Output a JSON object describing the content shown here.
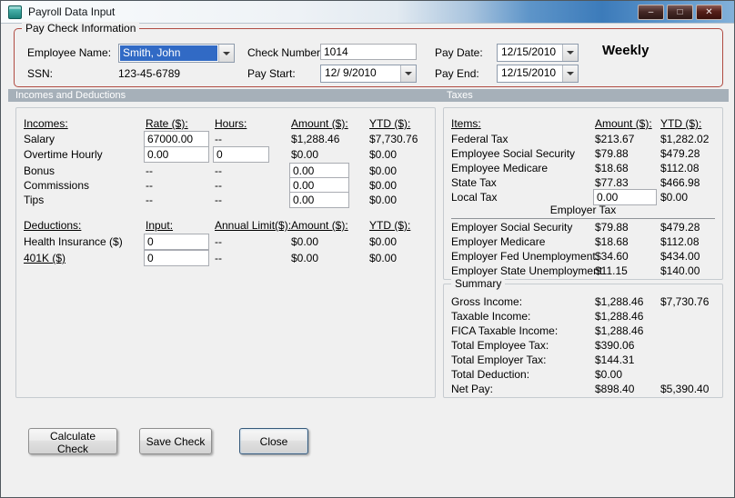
{
  "window": {
    "title": "Payroll Data Input",
    "buttons": {
      "minimize": "–",
      "maximize": "□",
      "close": "✕"
    }
  },
  "colors": {
    "paycheck_group_border": "#b04b42",
    "section_header_bg": "#a6b0b9",
    "selection_highlight": "#316ac5",
    "titlebar_blue": "#3c7bba"
  },
  "paycheck": {
    "group_label": "Pay Check Information",
    "employee_name_label": "Employee Name:",
    "employee_name_value": "Smith, John",
    "ssn_label": "SSN:",
    "ssn_value": "123-45-6789",
    "check_number_label": "Check Number:",
    "check_number_value": "1014",
    "pay_start_label": "Pay Start:",
    "pay_start_value": "12/ 9/2010",
    "pay_date_label": "Pay Date:",
    "pay_date_value": "12/15/2010",
    "pay_end_label": "Pay End:",
    "pay_end_value": "12/15/2010",
    "frequency": "Weekly"
  },
  "sections": {
    "incomes_deductions": "Incomes and Deductions",
    "taxes": "Taxes"
  },
  "incomes": {
    "headers": {
      "item": "Incomes:",
      "rate": "Rate ($):",
      "hours": "Hours:",
      "amount": "Amount ($):",
      "ytd": "YTD ($):"
    },
    "rows": [
      {
        "label": "Salary",
        "rate": "67000.00",
        "hours": "--",
        "amount": "$1,288.46",
        "ytd": "$7,730.76"
      },
      {
        "label": "Overtime Hourly",
        "rate": "0.00",
        "hours": "0",
        "amount": "$0.00",
        "ytd": "$0.00"
      },
      {
        "label": "Bonus",
        "rate": "--",
        "hours": "--",
        "amount": "0.00",
        "ytd": "$0.00"
      },
      {
        "label": "Commissions",
        "rate": "--",
        "hours": "--",
        "amount": "0.00",
        "ytd": "$0.00"
      },
      {
        "label": "Tips",
        "rate": "--",
        "hours": "--",
        "amount": "0.00",
        "ytd": "$0.00"
      }
    ]
  },
  "deductions": {
    "headers": {
      "item": "Deductions:",
      "input": "Input:",
      "annual_limit": "Annual Limit($):",
      "amount": "Amount ($):",
      "ytd": "YTD ($):"
    },
    "rows": [
      {
        "label": "Health Insurance ($)",
        "input": "0",
        "annual_limit": "--",
        "amount": "$0.00",
        "ytd": "$0.00"
      },
      {
        "label": "401K ($)",
        "input": "0",
        "annual_limit": "--",
        "amount": "$0.00",
        "ytd": "$0.00"
      }
    ]
  },
  "taxes": {
    "headers": {
      "item": "Items:",
      "amount": "Amount ($):",
      "ytd": "YTD ($):"
    },
    "employee_rows": [
      {
        "label": "Federal Tax",
        "amount": "$213.67",
        "ytd": "$1,282.02"
      },
      {
        "label": "Employee Social Security",
        "amount": "$79.88",
        "ytd": "$479.28"
      },
      {
        "label": "Employee Medicare",
        "amount": "$18.68",
        "ytd": "$112.08"
      },
      {
        "label": "State Tax",
        "amount": "$77.83",
        "ytd": "$466.98"
      },
      {
        "label": "Local Tax",
        "amount": "0.00",
        "ytd": "$0.00"
      }
    ],
    "employer_header": "Employer Tax",
    "employer_rows": [
      {
        "label": "Employer Social Security",
        "amount": "$79.88",
        "ytd": "$479.28"
      },
      {
        "label": "Employer Medicare",
        "amount": "$18.68",
        "ytd": "$112.08"
      },
      {
        "label": "Employer Fed Unemployment",
        "amount": "$34.60",
        "ytd": "$434.00"
      },
      {
        "label": "Employer State Unemployment",
        "amount": "$11.15",
        "ytd": "$140.00"
      }
    ]
  },
  "summary": {
    "group_label": "Summary",
    "rows": [
      {
        "label": "Gross Income:",
        "amount": "$1,288.46",
        "ytd": "$7,730.76"
      },
      {
        "label": "Taxable Income:",
        "amount": "$1,288.46",
        "ytd": ""
      },
      {
        "label": "FICA Taxable Income:",
        "amount": "$1,288.46",
        "ytd": ""
      },
      {
        "label": "Total Employee Tax:",
        "amount": "$390.06",
        "ytd": ""
      },
      {
        "label": "Total Employer Tax:",
        "amount": "$144.31",
        "ytd": ""
      },
      {
        "label": "Total Deduction:",
        "amount": "$0.00",
        "ytd": ""
      },
      {
        "label": "Net Pay:",
        "amount": "$898.40",
        "ytd": "$5,390.40"
      }
    ]
  },
  "footer_buttons": {
    "calculate": "Calculate Check",
    "save": "Save Check",
    "close": "Close"
  }
}
